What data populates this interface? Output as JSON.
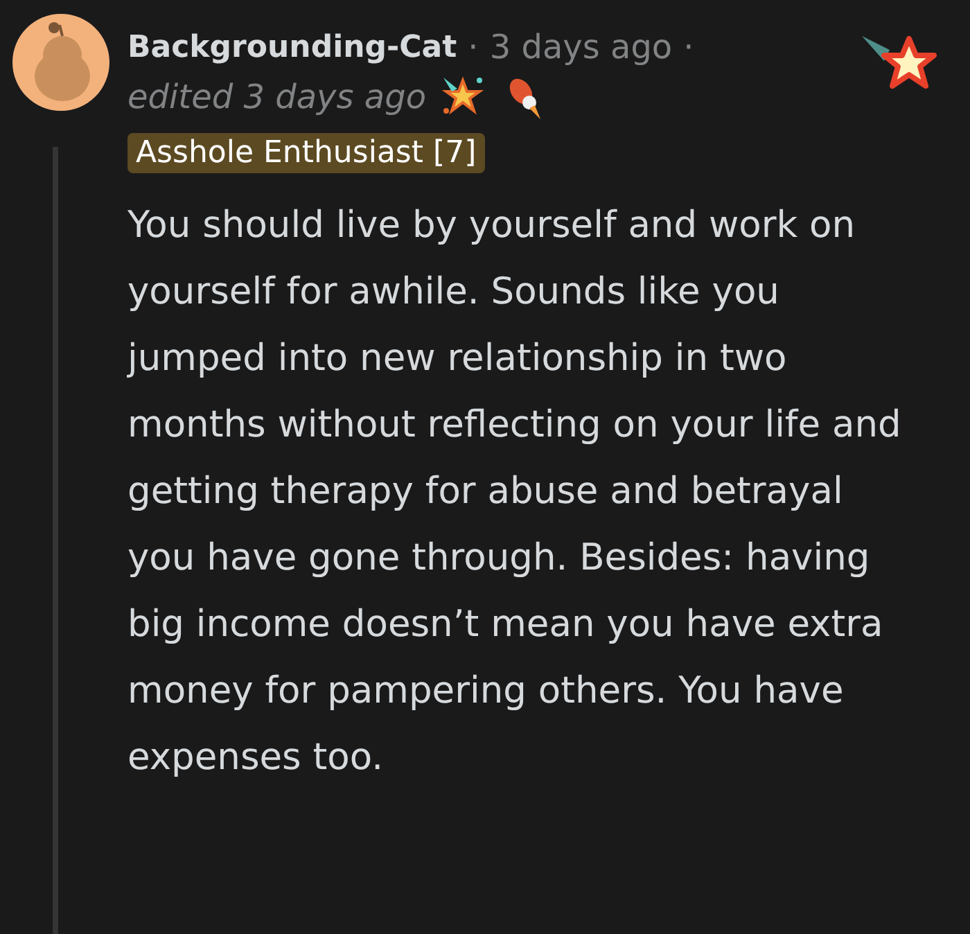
{
  "comment": {
    "author": "Backgrounding-Cat",
    "time": "3 days ago",
    "separator": "·",
    "edited": "edited 3 days ago",
    "flair": "Asshole Enthusiast [7]",
    "body": "You should live by yourself and work on yourself for awhile. Sounds like you jumped into new relationship in two months without reflecting on your life and getting therapy for abuse and betrayal you have gone through. Besides: having big income doesn’t mean you have extra money for pampering others. You have expenses too."
  }
}
